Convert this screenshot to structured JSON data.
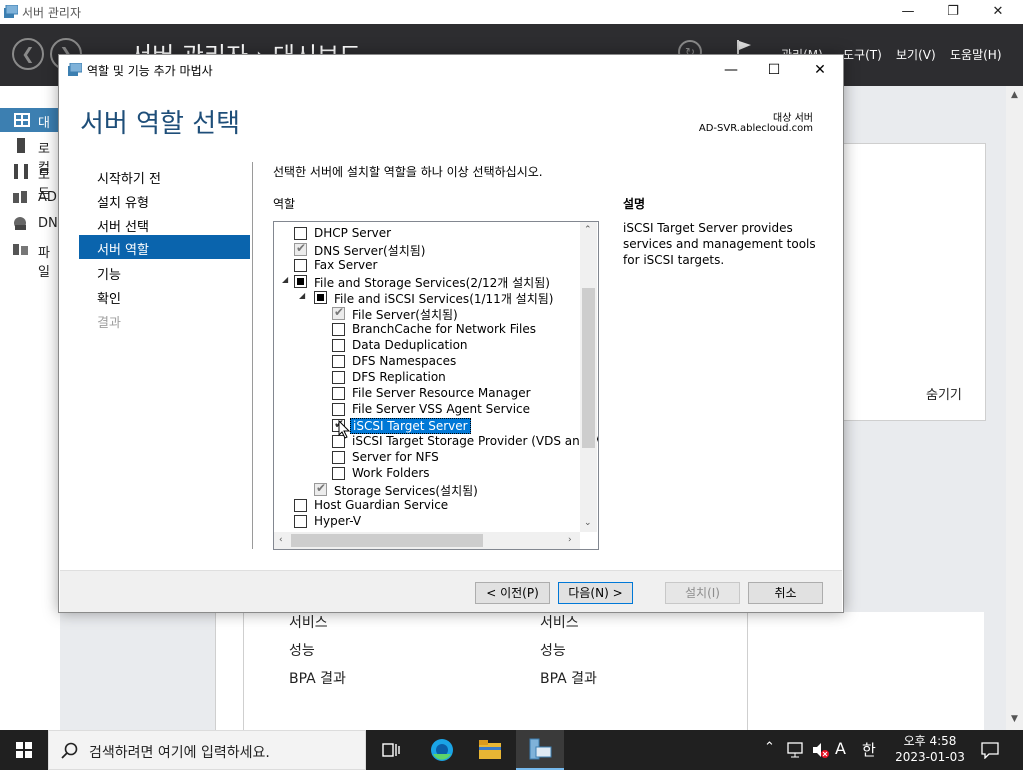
{
  "server_manager": {
    "window_title": "서버 관리자",
    "breadcrumb": "서버 관리자 › 대시보드",
    "menu": {
      "manage": "관리(M)",
      "tools": "도구(T)",
      "view": "보기(V)",
      "help": "도움말(H)"
    },
    "nav": [
      "대시",
      "로컬",
      "모든",
      "AD",
      "DN",
      "파일"
    ],
    "hide_label": "숨기기",
    "cards": [
      {
        "items": [
          "서비스",
          "성능",
          "BPA 결과"
        ]
      },
      {
        "items": [
          "서비스",
          "성능",
          "BPA 결과"
        ]
      }
    ]
  },
  "wizard": {
    "title": "역할 및 기능 추가 마법사",
    "heading": "서버 역할 선택",
    "destination_label": "대상 서버",
    "destination_server": "AD-SVR.ablecloud.com",
    "steps": [
      "시작하기 전",
      "설치 유형",
      "서버 선택",
      "서버 역할",
      "기능",
      "확인",
      "결과"
    ],
    "active_step": "서버 역할",
    "instruction": "선택한 서버에 설치할 역할을 하나 이상 선택하십시오.",
    "roles_label": "역할",
    "description_label": "설명",
    "description_text": "iSCSI Target Server provides services and management tools for iSCSI targets.",
    "roles": [
      {
        "label": "DHCP Server",
        "state": "unchecked"
      },
      {
        "label": "DNS Server(설치됨)",
        "state": "checked-disabled"
      },
      {
        "label": "Fax Server",
        "state": "unchecked"
      },
      {
        "label": "File and Storage Services(2/12개 설치됨)",
        "state": "partial"
      },
      {
        "label": "File and iSCSI Services(1/11개 설치됨)",
        "state": "partial"
      },
      {
        "label": "File Server(설치됨)",
        "state": "checked-disabled"
      },
      {
        "label": "BranchCache for Network Files",
        "state": "unchecked"
      },
      {
        "label": "Data Deduplication",
        "state": "unchecked"
      },
      {
        "label": "DFS Namespaces",
        "state": "unchecked"
      },
      {
        "label": "DFS Replication",
        "state": "unchecked"
      },
      {
        "label": "File Server Resource Manager",
        "state": "unchecked"
      },
      {
        "label": "File Server VSS Agent Service",
        "state": "unchecked"
      },
      {
        "label": "iSCSI Target Server",
        "state": "checked",
        "selected": true
      },
      {
        "label": "iSCSI Target Storage Provider (VDS and V",
        "state": "unchecked"
      },
      {
        "label": "Server for NFS",
        "state": "unchecked"
      },
      {
        "label": "Work Folders",
        "state": "unchecked"
      },
      {
        "label": "Storage Services(설치됨)",
        "state": "checked-disabled"
      },
      {
        "label": "Host Guardian Service",
        "state": "unchecked"
      },
      {
        "label": "Hyper-V",
        "state": "unchecked"
      }
    ],
    "buttons": {
      "previous": "< 이전(P)",
      "next": "다음(N) >",
      "install": "설치(I)",
      "cancel": "취소"
    }
  },
  "taskbar": {
    "search_placeholder": "검색하려면 여기에 입력하세요.",
    "ime_a": "A",
    "ime_han": "한",
    "time": "오후 4:58",
    "date": "2023-01-03"
  }
}
